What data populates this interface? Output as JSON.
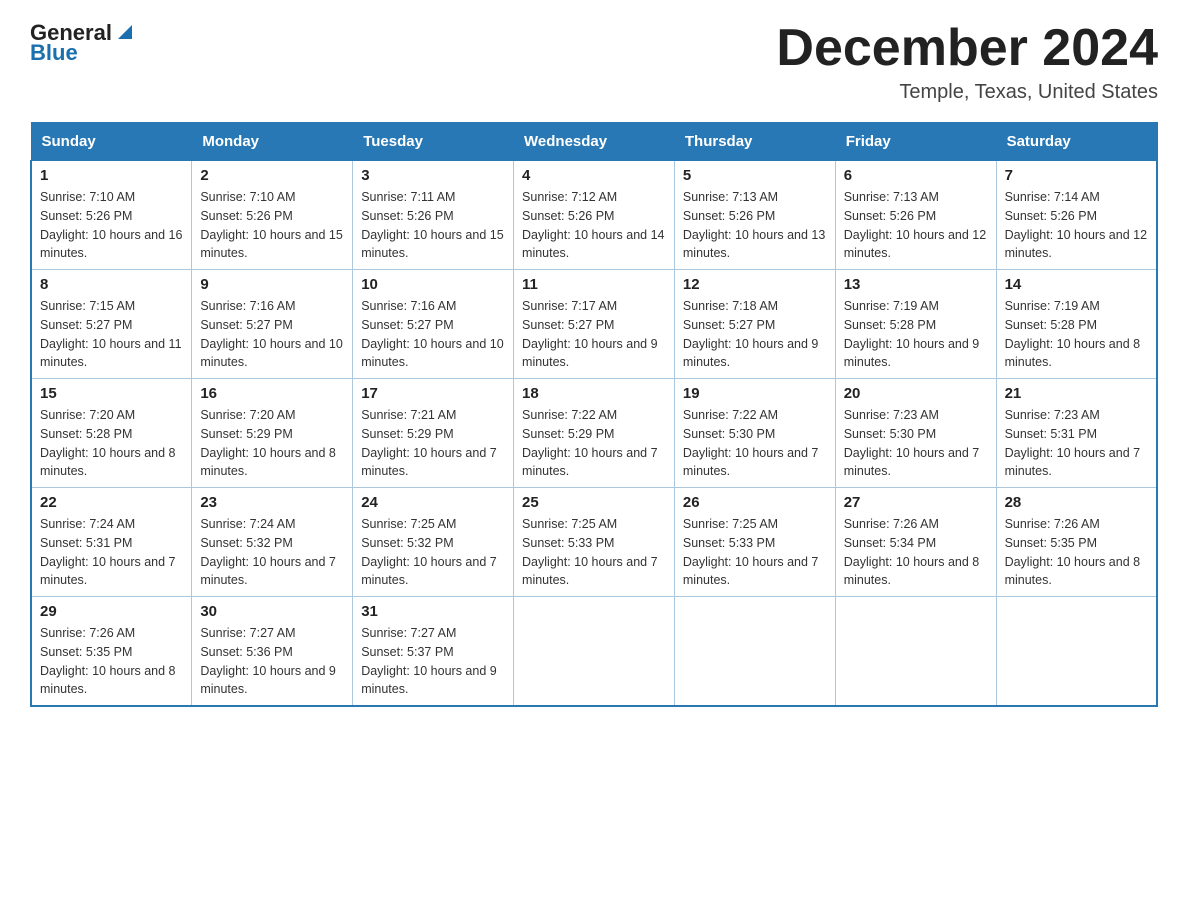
{
  "header": {
    "logo_general": "General",
    "logo_blue": "Blue",
    "month_title": "December 2024",
    "location": "Temple, Texas, United States"
  },
  "days_of_week": [
    "Sunday",
    "Monday",
    "Tuesday",
    "Wednesday",
    "Thursday",
    "Friday",
    "Saturday"
  ],
  "weeks": [
    [
      {
        "day": "1",
        "sunrise": "7:10 AM",
        "sunset": "5:26 PM",
        "daylight": "10 hours and 16 minutes."
      },
      {
        "day": "2",
        "sunrise": "7:10 AM",
        "sunset": "5:26 PM",
        "daylight": "10 hours and 15 minutes."
      },
      {
        "day": "3",
        "sunrise": "7:11 AM",
        "sunset": "5:26 PM",
        "daylight": "10 hours and 15 minutes."
      },
      {
        "day": "4",
        "sunrise": "7:12 AM",
        "sunset": "5:26 PM",
        "daylight": "10 hours and 14 minutes."
      },
      {
        "day": "5",
        "sunrise": "7:13 AM",
        "sunset": "5:26 PM",
        "daylight": "10 hours and 13 minutes."
      },
      {
        "day": "6",
        "sunrise": "7:13 AM",
        "sunset": "5:26 PM",
        "daylight": "10 hours and 12 minutes."
      },
      {
        "day": "7",
        "sunrise": "7:14 AM",
        "sunset": "5:26 PM",
        "daylight": "10 hours and 12 minutes."
      }
    ],
    [
      {
        "day": "8",
        "sunrise": "7:15 AM",
        "sunset": "5:27 PM",
        "daylight": "10 hours and 11 minutes."
      },
      {
        "day": "9",
        "sunrise": "7:16 AM",
        "sunset": "5:27 PM",
        "daylight": "10 hours and 10 minutes."
      },
      {
        "day": "10",
        "sunrise": "7:16 AM",
        "sunset": "5:27 PM",
        "daylight": "10 hours and 10 minutes."
      },
      {
        "day": "11",
        "sunrise": "7:17 AM",
        "sunset": "5:27 PM",
        "daylight": "10 hours and 9 minutes."
      },
      {
        "day": "12",
        "sunrise": "7:18 AM",
        "sunset": "5:27 PM",
        "daylight": "10 hours and 9 minutes."
      },
      {
        "day": "13",
        "sunrise": "7:19 AM",
        "sunset": "5:28 PM",
        "daylight": "10 hours and 9 minutes."
      },
      {
        "day": "14",
        "sunrise": "7:19 AM",
        "sunset": "5:28 PM",
        "daylight": "10 hours and 8 minutes."
      }
    ],
    [
      {
        "day": "15",
        "sunrise": "7:20 AM",
        "sunset": "5:28 PM",
        "daylight": "10 hours and 8 minutes."
      },
      {
        "day": "16",
        "sunrise": "7:20 AM",
        "sunset": "5:29 PM",
        "daylight": "10 hours and 8 minutes."
      },
      {
        "day": "17",
        "sunrise": "7:21 AM",
        "sunset": "5:29 PM",
        "daylight": "10 hours and 7 minutes."
      },
      {
        "day": "18",
        "sunrise": "7:22 AM",
        "sunset": "5:29 PM",
        "daylight": "10 hours and 7 minutes."
      },
      {
        "day": "19",
        "sunrise": "7:22 AM",
        "sunset": "5:30 PM",
        "daylight": "10 hours and 7 minutes."
      },
      {
        "day": "20",
        "sunrise": "7:23 AM",
        "sunset": "5:30 PM",
        "daylight": "10 hours and 7 minutes."
      },
      {
        "day": "21",
        "sunrise": "7:23 AM",
        "sunset": "5:31 PM",
        "daylight": "10 hours and 7 minutes."
      }
    ],
    [
      {
        "day": "22",
        "sunrise": "7:24 AM",
        "sunset": "5:31 PM",
        "daylight": "10 hours and 7 minutes."
      },
      {
        "day": "23",
        "sunrise": "7:24 AM",
        "sunset": "5:32 PM",
        "daylight": "10 hours and 7 minutes."
      },
      {
        "day": "24",
        "sunrise": "7:25 AM",
        "sunset": "5:32 PM",
        "daylight": "10 hours and 7 minutes."
      },
      {
        "day": "25",
        "sunrise": "7:25 AM",
        "sunset": "5:33 PM",
        "daylight": "10 hours and 7 minutes."
      },
      {
        "day": "26",
        "sunrise": "7:25 AM",
        "sunset": "5:33 PM",
        "daylight": "10 hours and 7 minutes."
      },
      {
        "day": "27",
        "sunrise": "7:26 AM",
        "sunset": "5:34 PM",
        "daylight": "10 hours and 8 minutes."
      },
      {
        "day": "28",
        "sunrise": "7:26 AM",
        "sunset": "5:35 PM",
        "daylight": "10 hours and 8 minutes."
      }
    ],
    [
      {
        "day": "29",
        "sunrise": "7:26 AM",
        "sunset": "5:35 PM",
        "daylight": "10 hours and 8 minutes."
      },
      {
        "day": "30",
        "sunrise": "7:27 AM",
        "sunset": "5:36 PM",
        "daylight": "10 hours and 9 minutes."
      },
      {
        "day": "31",
        "sunrise": "7:27 AM",
        "sunset": "5:37 PM",
        "daylight": "10 hours and 9 minutes."
      },
      null,
      null,
      null,
      null
    ]
  ],
  "labels": {
    "sunrise": "Sunrise:",
    "sunset": "Sunset:",
    "daylight": "Daylight:"
  }
}
